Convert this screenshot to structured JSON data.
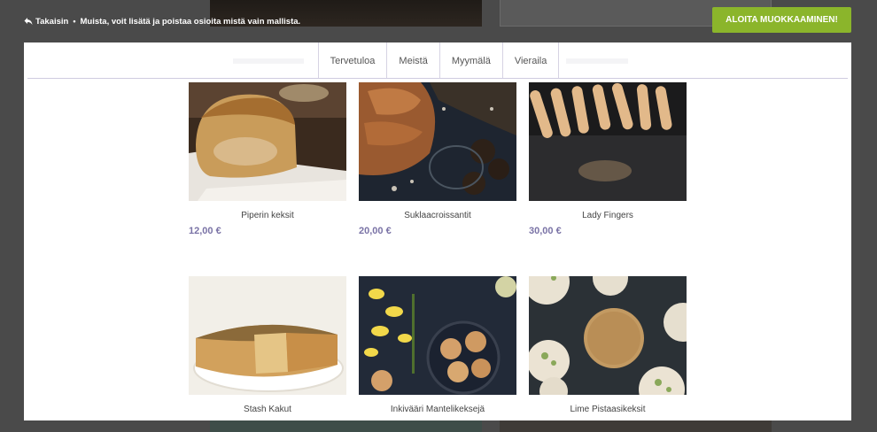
{
  "topbar": {
    "back_label": "Takaisin",
    "separator": "•",
    "notice_text": "Muista, voit lisätä ja poistaa osioita mistä vain mallista.",
    "cta_label": "ALOITA MUOKKAAMINEN!"
  },
  "nav": {
    "items": [
      "Tervetuloa",
      "Meistä",
      "Myymälä",
      "Vieraila"
    ]
  },
  "products": [
    {
      "name": "Piperin keksit",
      "price": "12,00 €",
      "image": "bread-loaf-photo"
    },
    {
      "name": "Suklaacroissantit",
      "price": "20,00 €",
      "image": "croissant-photo"
    },
    {
      "name": "Lady Fingers",
      "price": "30,00 €",
      "image": "lady-fingers-photo"
    },
    {
      "name": "Stash Kakut",
      "price": "",
      "image": "quiche-photo"
    },
    {
      "name": "Inkivääri Mantelikeksejä",
      "price": "",
      "image": "almond-cookies-photo"
    },
    {
      "name": "Lime Pistaasikeksit",
      "price": "",
      "image": "pistachio-cookies-photo"
    }
  ],
  "colors": {
    "cta": "#8bb52b",
    "price": "#7a73a6",
    "overlay": "#4a4a4a"
  }
}
